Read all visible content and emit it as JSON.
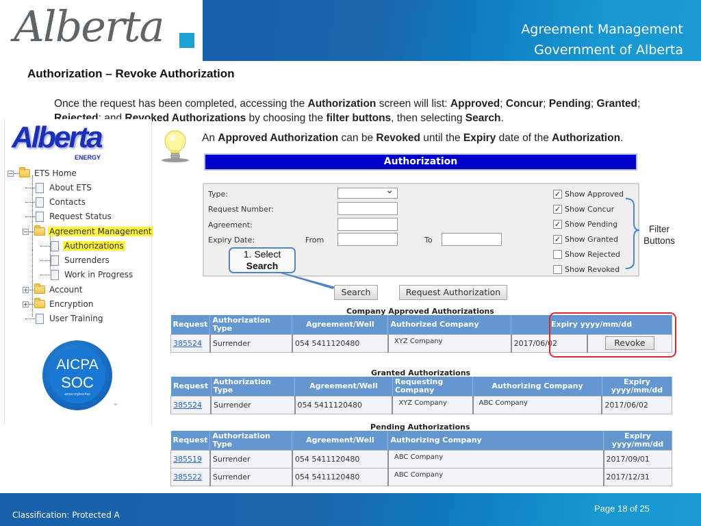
{
  "header": {
    "logo_text": "Alberta",
    "line1": "Agreement Management",
    "line2": "Government of Alberta",
    "colors": {
      "band": "#1a66ad",
      "accent_square": "#1ea1d2"
    }
  },
  "slide_title": "Authorization – Revoke Authorization",
  "intro": {
    "parts": [
      {
        "t": "Once the request has been completed, accessing the ",
        "b": false
      },
      {
        "t": "Authorization",
        "b": true
      },
      {
        "t": " screen will list: ",
        "b": false
      },
      {
        "t": "Approved",
        "b": true
      },
      {
        "t": "; ",
        "b": false
      },
      {
        "t": "Concur",
        "b": true
      },
      {
        "t": "; ",
        "b": false
      },
      {
        "t": "Pending",
        "b": true
      },
      {
        "t": "; ",
        "b": false
      },
      {
        "t": "Granted",
        "b": true
      },
      {
        "t": "; ",
        "b": false
      },
      {
        "t": "Rejected",
        "b": true
      },
      {
        "t": "; and ",
        "b": false
      },
      {
        "t": "Revoked  Authorizations",
        "b": true
      },
      {
        "t": " by choosing the ",
        "b": false
      },
      {
        "t": "filter buttons",
        "b": true
      },
      {
        "t": ", then selecting ",
        "b": false
      },
      {
        "t": "Search",
        "b": true
      },
      {
        "t": ".",
        "b": false
      }
    ]
  },
  "tip": {
    "icon": "lightbulb-icon",
    "parts": [
      {
        "t": "An ",
        "b": false
      },
      {
        "t": "Approved Authorization",
        "b": true
      },
      {
        "t": " can be ",
        "b": false
      },
      {
        "t": "Revoked",
        "b": true
      },
      {
        "t": " until the ",
        "b": false
      },
      {
        "t": "Expiry",
        "b": true
      },
      {
        "t": " date of the ",
        "b": false
      },
      {
        "t": "Authorization",
        "b": true
      },
      {
        "t": ".",
        "b": false
      }
    ]
  },
  "nav": {
    "logo_word": "Alberta",
    "logo_sub": "ENERGY",
    "tree": [
      {
        "label": "ETS Home",
        "type": "folder",
        "toggle": "−",
        "highlight": false
      },
      {
        "label": "About ETS",
        "type": "doc",
        "highlight": false
      },
      {
        "label": "Contacts",
        "type": "doc",
        "highlight": false
      },
      {
        "label": "Request Status",
        "type": "doc",
        "highlight": false
      },
      {
        "label": "Agreement Management",
        "type": "folder",
        "toggle": "−",
        "highlight": true
      },
      {
        "label": "Authorizations",
        "type": "doc",
        "highlight": true
      },
      {
        "label": "Surrenders",
        "type": "doc",
        "highlight": false
      },
      {
        "label": "Work in Progress",
        "type": "doc",
        "highlight": false
      },
      {
        "label": "Account",
        "type": "folder",
        "toggle": "+",
        "highlight": false
      },
      {
        "label": "Encryption",
        "type": "folder",
        "toggle": "+",
        "highlight": false
      },
      {
        "label": "User Training",
        "type": "doc",
        "highlight": false
      }
    ],
    "badge": {
      "line1": "AICPA",
      "line2": "SOC",
      "line3": "aicpa.org/soc4so",
      "tm": "™"
    }
  },
  "auth": {
    "title": "Authorization",
    "form": {
      "type_label": "Type:",
      "type_value": "",
      "request_number_label": "Request Number:",
      "request_number_value": "",
      "agreement_label": "Agreement:",
      "agreement_value": "",
      "expiry_label": "Expiry Date:",
      "from_label": "From",
      "from_value": "",
      "to_label": "To",
      "to_value": ""
    },
    "filters": [
      {
        "label": "Show Approved",
        "checked": true
      },
      {
        "label": "Show Concur",
        "checked": true
      },
      {
        "label": "Show Pending",
        "checked": true
      },
      {
        "label": "Show Granted",
        "checked": true
      },
      {
        "label": "Show Rejected",
        "checked": false
      },
      {
        "label": "Show Revoked",
        "checked": false
      }
    ],
    "filter_annotation": "Filter Buttons",
    "callout_line1": "1. Select",
    "callout_line2": "Search",
    "search_button": "Search",
    "request_auth_button": "Request Authorization"
  },
  "tables": {
    "approved": {
      "caption": "Company Approved Authorizations",
      "headers": [
        "Request",
        "Authorization Type",
        "Agreement/Well",
        "Authorized Company",
        "Expiry yyyy/mm/dd"
      ],
      "rows": [
        {
          "request": "385524",
          "type": "Surrender",
          "agreement": "054 5411120480",
          "company": "XYZ Company",
          "expiry": "2017/06/02",
          "action": "Revoke"
        }
      ]
    },
    "granted": {
      "caption": "Granted Authorizations",
      "headers": [
        "Request",
        "Authorization Type",
        "Agreement/Well",
        "Requesting Company",
        "Authorizing Company",
        "Expiry yyyy/mm/dd"
      ],
      "rows": [
        {
          "request": "385524",
          "type": "Surrender",
          "agreement": "054 5411120480",
          "requesting": "XYZ Company",
          "authorizing": "ABC Company",
          "expiry": "2017/06/02"
        }
      ]
    },
    "pending": {
      "caption": "Pending Authorizations",
      "headers": [
        "Request",
        "Authorization Type",
        "Agreement/Well",
        "Authorizing Company",
        "Expiry yyyy/mm/dd"
      ],
      "rows": [
        {
          "request": "385519",
          "type": "Surrender",
          "agreement": "054 5411120480",
          "company": "ABC Company",
          "expiry": "2017/09/01"
        },
        {
          "request": "385522",
          "type": "Surrender",
          "agreement": "054 5411120480",
          "company": "ABC Company",
          "expiry": "2017/12/31"
        }
      ]
    }
  },
  "footer": {
    "classification": "Classification: Protected A",
    "page": "Page 18 of 25"
  }
}
